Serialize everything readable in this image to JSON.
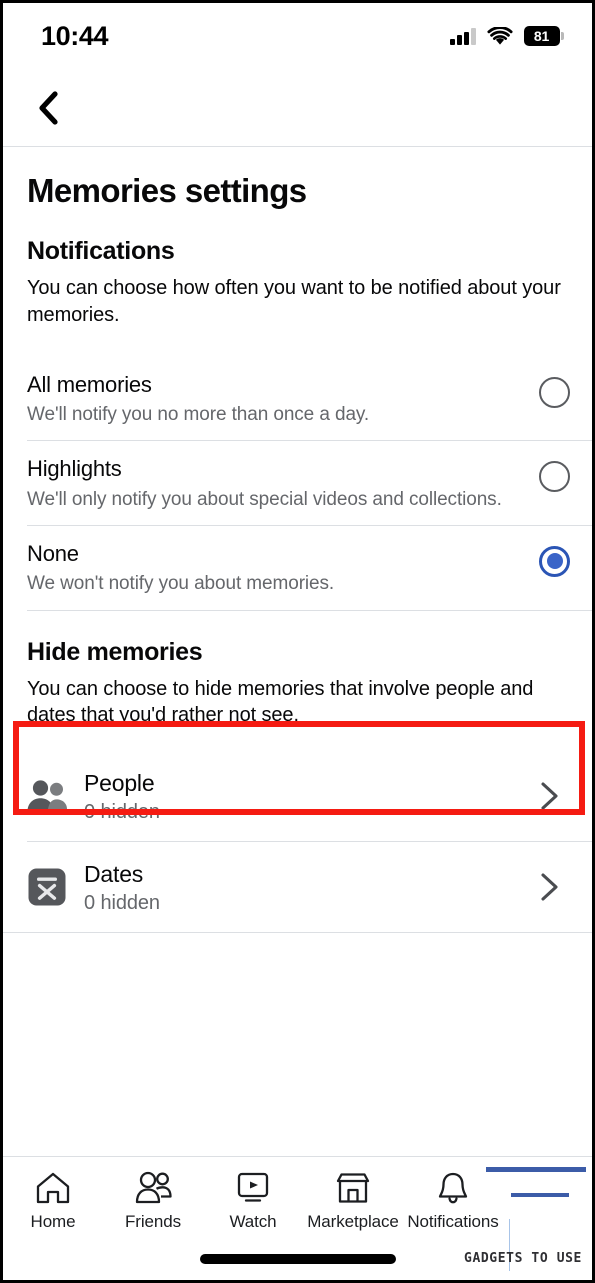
{
  "status_bar": {
    "time": "10:44",
    "battery_level": "81",
    "cell_icon": "cellular-signal-icon",
    "wifi_icon": "wifi-icon",
    "battery_icon": "battery-icon"
  },
  "nav": {
    "back_icon": "chevron-left-icon"
  },
  "page": {
    "title": "Memories settings"
  },
  "notifications": {
    "heading": "Notifications",
    "description": "You can choose how often you want to be notified about your memories.",
    "options": [
      {
        "title": "All memories",
        "subtitle": "We'll notify you no more than once a day.",
        "selected": false
      },
      {
        "title": "Highlights",
        "subtitle": "We'll only notify you about special videos and collections.",
        "selected": false
      },
      {
        "title": "None",
        "subtitle": "We won't notify you about memories.",
        "selected": true
      }
    ]
  },
  "hide_memories": {
    "heading": "Hide memories",
    "description": "You can choose to hide memories that involve people and dates that you'd rather not see.",
    "rows": [
      {
        "title": "People",
        "subtitle": "0 hidden",
        "icon": "people-icon",
        "chevron": "chevron-right-icon",
        "highlighted": true
      },
      {
        "title": "Dates",
        "subtitle": "0 hidden",
        "icon": "calendar-x-icon",
        "chevron": "chevron-right-icon",
        "highlighted": false
      }
    ]
  },
  "tabbar": {
    "items": [
      {
        "label": "Home",
        "icon": "home-icon"
      },
      {
        "label": "Friends",
        "icon": "friends-icon"
      },
      {
        "label": "Watch",
        "icon": "watch-video-icon"
      },
      {
        "label": "Marketplace",
        "icon": "marketplace-store-icon"
      },
      {
        "label": "Notifications",
        "icon": "bell-icon"
      }
    ]
  },
  "watermark": {
    "text": "GADGETS TO USE"
  },
  "colors": {
    "accent_blue": "#3a64c8",
    "highlight_red": "#f51b12",
    "secondary_text": "#65676b",
    "divider": "#dcdfe3"
  }
}
